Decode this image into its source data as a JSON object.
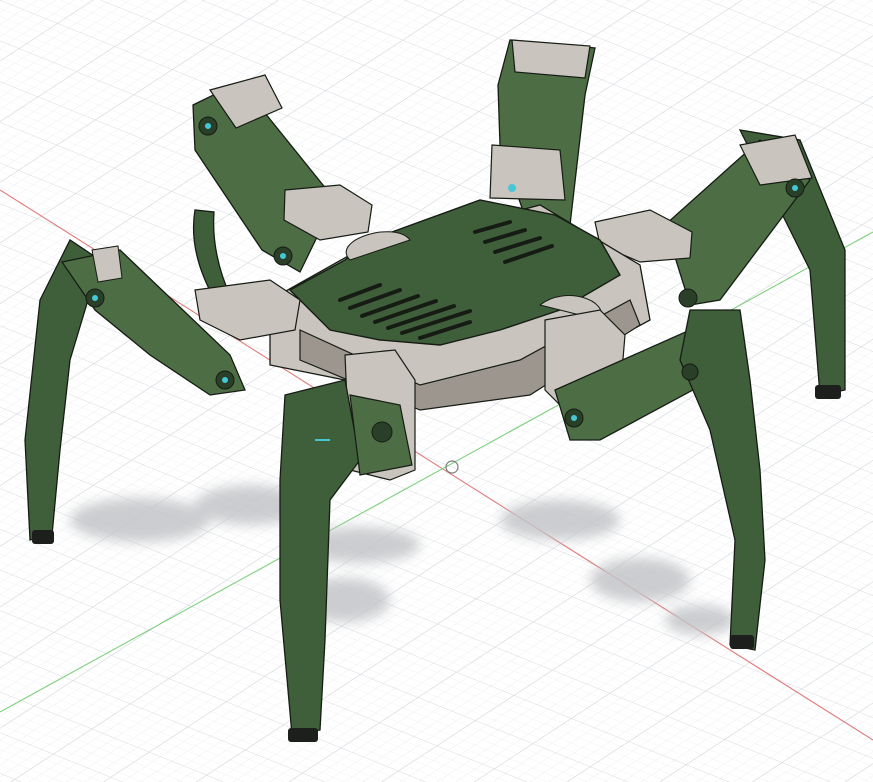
{
  "scene": {
    "subject": "hexapod-robot-cad-model",
    "colors": {
      "background": "#ffffff",
      "grid_minor": "#e9ecef",
      "grid_major": "#d3d8dd",
      "axis_x": "#e07a7a",
      "axis_y": "#7fd07f",
      "body_green": "#3f5f3a",
      "body_green_light": "#4d6e45",
      "body_green_dark": "#2a3f27",
      "servo_grey": "#c9c4bd",
      "servo_grey_dark": "#9c968e",
      "shadow": "#c3c5c8",
      "accent": "#46c7d6",
      "outline": "#161c14"
    }
  }
}
